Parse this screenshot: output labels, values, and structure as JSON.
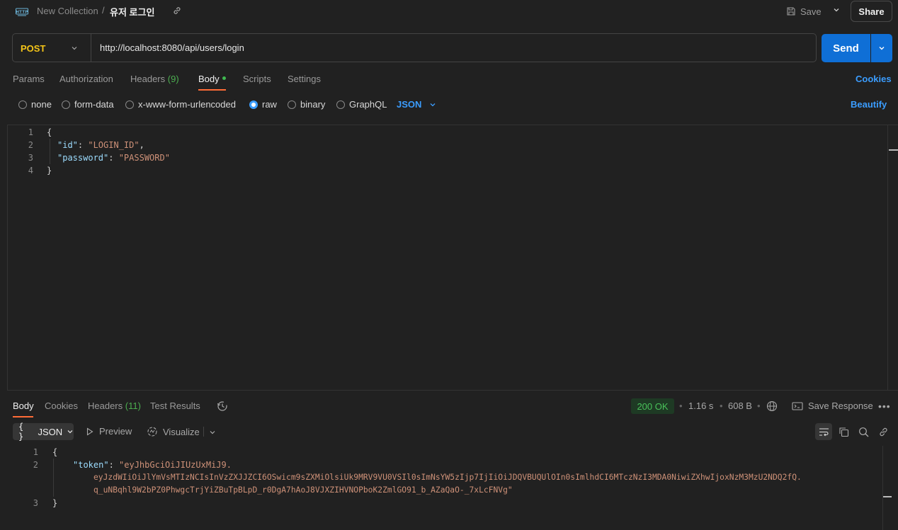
{
  "header": {
    "icon_label": "HTTP",
    "collection": "New Collection",
    "separator": "/",
    "request_name": "유저 로그인",
    "save_label": "Save",
    "share_label": "Share"
  },
  "request": {
    "method": "POST",
    "url": "http://localhost:8080/api/users/login",
    "send_label": "Send"
  },
  "tabs": {
    "params": "Params",
    "authorization": "Authorization",
    "headers": "Headers",
    "headers_count": "(9)",
    "body": "Body",
    "scripts": "Scripts",
    "settings": "Settings",
    "cookies": "Cookies"
  },
  "body_options": {
    "none": "none",
    "form_data": "form-data",
    "urlencoded": "x-www-form-urlencoded",
    "raw": "raw",
    "binary": "binary",
    "graphql": "GraphQL",
    "format": "JSON",
    "beautify": "Beautify",
    "selected": "raw"
  },
  "request_body": {
    "line_numbers": [
      "1",
      "2",
      "3",
      "4"
    ],
    "open": "{",
    "id_key": "\"id\"",
    "id_value": "\"LOGIN_ID\"",
    "password_key": "\"password\"",
    "password_value": "\"PASSWORD\"",
    "close": "}"
  },
  "response_tabs": {
    "body": "Body",
    "cookies": "Cookies",
    "headers": "Headers",
    "headers_count": "(11)",
    "test_results": "Test Results"
  },
  "response_meta": {
    "status": "200 OK",
    "time": "1.16 s",
    "size": "608 B",
    "save_response": "Save Response"
  },
  "response_toolbar": {
    "format": "JSON",
    "preview": "Preview",
    "visualize": "Visualize"
  },
  "response_body": {
    "line_numbers": [
      "1",
      "2",
      "3"
    ],
    "open": "{",
    "token_key": "\"token\"",
    "token_line1": "\"eyJhbGciOiJIUzUxMiJ9.",
    "token_line2": "eyJzdWIiOiJlYmVsMTIzNCIsInVzZXJJZCI6OSwicm9sZXMiOlsiUk9MRV9VU0VSIl0sImNsYW5zIjp7IjIiOiJDQVBUQUlOIn0sImlhdCI6MTczNzI3MDA0NiwiZXhwIjoxNzM3MzU2NDQ2fQ.",
    "token_line3": "q_uNBqhl9W2bPZ0PhwgcTrjYiZBuTpBLpD_r0DgA7hAoJ8VJXZIHVNOPboK2ZmlGO91_b_AZaQaO-_7xLcFNVg\"",
    "close": "}"
  },
  "colors": {
    "accent_blue": "#0f6fd6",
    "method_yellow": "#f5c518",
    "tab_underline": "#ff6c37",
    "status_green": "#49c25a"
  }
}
